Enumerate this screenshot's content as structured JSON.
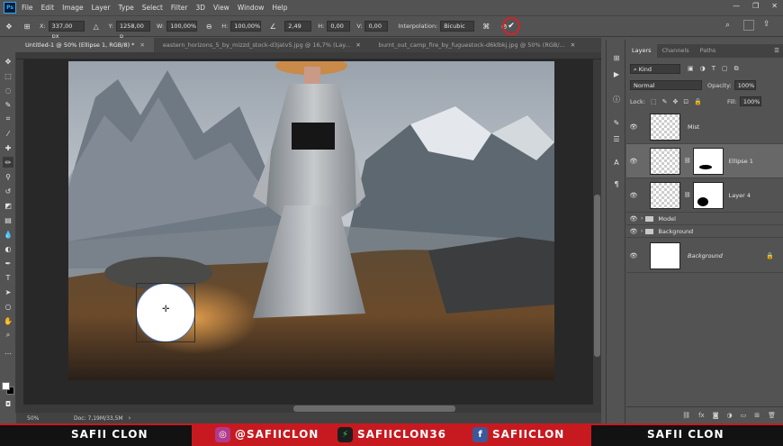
{
  "app": {
    "logo_text": "Ps",
    "menu": [
      "File",
      "Edit",
      "Image",
      "Layer",
      "Type",
      "Select",
      "Filter",
      "3D",
      "View",
      "Window",
      "Help"
    ]
  },
  "options_bar": {
    "x_label": "X:",
    "x_value": "337,00 px",
    "y_label": "Y:",
    "y_value": "1258,00 p",
    "w_label": "W:",
    "w_value": "100,00%",
    "h_label": "H:",
    "h_value": "100,00%",
    "angle_value": "2,49",
    "h_skew_label": "H:",
    "h_skew_value": "0,00",
    "v_skew_label": "V:",
    "v_skew_value": "0,00",
    "interpolation_label": "Interpolation:",
    "interpolation_value": "Bicubic"
  },
  "tabs": [
    {
      "label": "Untitled-1 @ 50% (Ellipse 1, RGB/8) *",
      "active": true
    },
    {
      "label": "eastern_horizons_5_by_mizzd_stock-d3jatv5.jpg @ 16,7% (Lay...",
      "active": false
    },
    {
      "label": "burnt_out_camp_fire_by_fuguestock-d6klbkj.jpg @ 50% (RGB/...",
      "active": false
    }
  ],
  "status": {
    "zoom": "50%",
    "doc": "Doc: 7,19M/33,5M"
  },
  "layers_panel": {
    "tabs": [
      "Layers",
      "Channels",
      "Paths"
    ],
    "kind_placeholder": "Kind",
    "blend_mode": "Normal",
    "opacity_label": "Opacity:",
    "opacity_value": "100%",
    "lock_label": "Lock:",
    "fill_label": "Fill:",
    "fill_value": "100%",
    "layers": [
      {
        "name": "Mist"
      },
      {
        "name": "Ellipse 1"
      },
      {
        "name": "Layer 4"
      },
      {
        "name": "Model"
      },
      {
        "name": "Background"
      },
      {
        "name": "Background"
      }
    ]
  },
  "brand_bar": {
    "left_name": "SAFII CLON",
    "instagram": "@SAFIICLON",
    "fiverr": "SAFIICLON36",
    "facebook": "SAFIICLON",
    "right_name": "SAFII CLON"
  },
  "colors": {
    "brand_red": "#c71a20",
    "ps_blue": "#31a8ff",
    "commit_circle": "#d0232a"
  }
}
